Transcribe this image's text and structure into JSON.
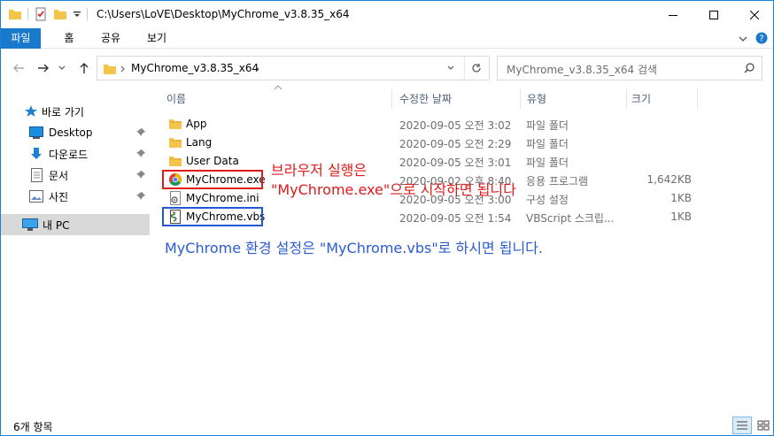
{
  "window": {
    "title": "C:\\Users\\LoVE\\Desktop\\MyChrome_v3.8.35_x64",
    "controls": [
      "minimize",
      "maximize",
      "close"
    ]
  },
  "ribbon": {
    "tabs": [
      {
        "label": "파일",
        "active": true
      },
      {
        "label": "홈"
      },
      {
        "label": "공유"
      },
      {
        "label": "보기"
      }
    ]
  },
  "address": {
    "crumb": "MyChrome_v3.8.35_x64"
  },
  "search": {
    "placeholder": "MyChrome_v3.8.35_x64 검색"
  },
  "nav": {
    "items": [
      {
        "label": "바로 가기",
        "icon": "star-icon"
      },
      {
        "label": "Desktop",
        "icon": "desktop-icon",
        "pinned": true
      },
      {
        "label": "다운로드",
        "icon": "download-icon",
        "pinned": true
      },
      {
        "label": "문서",
        "icon": "document-icon",
        "pinned": true
      },
      {
        "label": "사진",
        "icon": "pictures-icon",
        "pinned": true
      },
      {
        "label": "내 PC",
        "icon": "computer-icon",
        "selected": true
      }
    ]
  },
  "columns": {
    "name": "이름",
    "date": "수정한 날짜",
    "type": "유형",
    "size": "크기"
  },
  "files": [
    {
      "name": "App",
      "date": "2020-09-05 오전 3:02",
      "type": "파일 폴더",
      "size": "",
      "icon": "folder-icon"
    },
    {
      "name": "Lang",
      "date": "2020-09-05 오전 2:29",
      "type": "파일 폴더",
      "size": "",
      "icon": "folder-icon"
    },
    {
      "name": "User Data",
      "date": "2020-09-05 오전 3:01",
      "type": "파일 폴더",
      "size": "",
      "icon": "folder-icon"
    },
    {
      "name": "MyChrome.exe",
      "date": "2020-09-02 오후 8:40",
      "type": "응용 프로그램",
      "size": "1,642KB",
      "icon": "chrome-icon"
    },
    {
      "name": "MyChrome.ini",
      "date": "2020-09-05 오전 3:00",
      "type": "구성 설정",
      "size": "1KB",
      "icon": "settings-file-icon"
    },
    {
      "name": "MyChrome.vbs",
      "date": "2020-09-05 오전 1:54",
      "type": "VBScript 스크립...",
      "size": "1KB",
      "icon": "script-icon"
    }
  ],
  "annotations": {
    "exe_line1": "브라우저 실행은",
    "exe_line2": "\"MyChrome.exe\"으로 시작하면 됩니다",
    "vbs_note": "MyChrome 환경 설정은 \"MyChrome.vbs\"로 하시면 됩니다."
  },
  "status": {
    "count": "6개 항목"
  },
  "colors": {
    "accent": "#1979ca",
    "annotation_red": "#e11a1a",
    "annotation_blue": "#2b5ccf",
    "folder": "#f4c44b"
  }
}
